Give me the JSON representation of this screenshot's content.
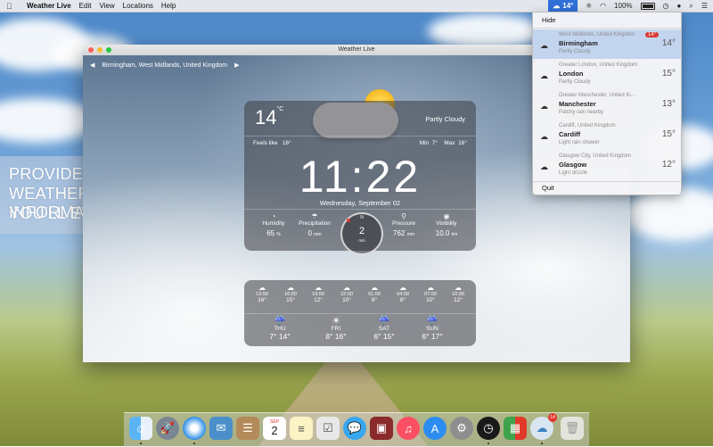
{
  "menubar": {
    "app_name": "Weather Live",
    "menus": [
      "Edit",
      "View",
      "Locations",
      "Help"
    ],
    "status_temp": "14°",
    "battery": "100%"
  },
  "promo": {
    "lines": [
      "PROVIDES ALL",
      "WEATHER INFORMATION",
      "YOU'LL EVER NEED"
    ]
  },
  "window": {
    "title": "Weather Live",
    "location": "Birmingham, West Midlands, United Kingdom",
    "current": {
      "temp": "14",
      "unit": "°C",
      "condition": "Partly Cloudy",
      "feels_like_label": "Feels like",
      "feels_like": "16°",
      "min_label": "Min",
      "min": "7°",
      "max_label": "Max",
      "max": "16°",
      "time": "11:22",
      "date": "Wednesday, September 02"
    },
    "metrics": {
      "humidity_label": "Humidity",
      "humidity": "65",
      "humidity_unit": "%",
      "precip_label": "Precipitation",
      "precip": "0",
      "precip_unit": "mm",
      "pressure_label": "Pressure",
      "pressure": "762",
      "pressure_unit": "mm",
      "visibility_label": "Visibility",
      "visibility": "10.0",
      "visibility_unit": "km",
      "wind_dir": "N",
      "wind_speed": "2",
      "wind_unit": "m/s"
    },
    "hourly": [
      {
        "time": "13:00",
        "temp": "16°"
      },
      {
        "time": "16:00",
        "temp": "15°"
      },
      {
        "time": "19:00",
        "temp": "12°"
      },
      {
        "time": "22:00",
        "temp": "10°"
      },
      {
        "time": "01:00",
        "temp": "8°"
      },
      {
        "time": "04:00",
        "temp": "8°"
      },
      {
        "time": "07:00",
        "temp": "10°"
      },
      {
        "time": "10:00",
        "temp": "12°"
      }
    ],
    "daily": [
      {
        "day": "THU",
        "low": "7°",
        "high": "14°"
      },
      {
        "day": "FRI",
        "low": "8°",
        "high": "16°"
      },
      {
        "day": "SAT",
        "low": "6°",
        "high": "15°"
      },
      {
        "day": "SUN",
        "low": "6°",
        "high": "17°"
      }
    ]
  },
  "dropdown": {
    "hide_label": "Hide",
    "quit_label": "Quit",
    "locations": [
      {
        "region": "West Midlands, United Kingdom",
        "city": "Birmingham",
        "condition": "Partly Cloudy",
        "temp": "14°",
        "badge": "14°"
      },
      {
        "region": "Greater London, United Kingdom",
        "city": "London",
        "condition": "Partly Cloudy",
        "temp": "15°"
      },
      {
        "region": "Greater Manchester, United Ki...",
        "city": "Manchester",
        "condition": "Patchy rain nearby",
        "temp": "13°"
      },
      {
        "region": "Cardiff, United Kingdom",
        "city": "Cardiff",
        "condition": "Light rain shower",
        "temp": "15°"
      },
      {
        "region": "Glasgow City, United Kingdom",
        "city": "Glasgow",
        "condition": "Light drizzle",
        "temp": "12°"
      }
    ]
  },
  "dock": {
    "calendar_month": "SEP",
    "calendar_day": "2",
    "weather_badge": "14"
  }
}
